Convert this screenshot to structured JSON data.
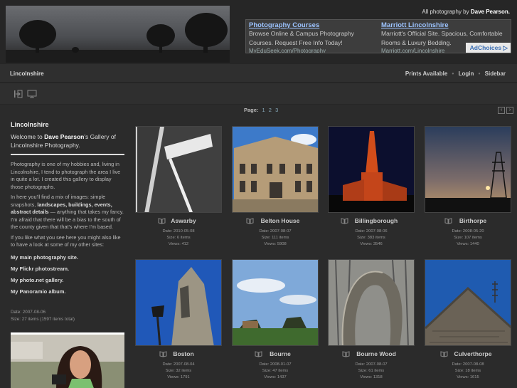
{
  "header": {
    "credit_prefix": "All photography by",
    "credit_name": "Dave Pearson."
  },
  "ad": {
    "items": [
      {
        "title": "Photography Courses",
        "body": "Browse Online & Campus Photography Courses. Request Free Info Today!",
        "url": "MyEduSeek.com/Photography"
      },
      {
        "title": "Marriott Lincolnshire",
        "body": "Marriott's Official Site. Spacious, Comfortable Rooms & Luxury Bedding.",
        "url": "Marriott.com/Lincolnshire"
      }
    ],
    "adchoices": "AdChoices"
  },
  "nav": {
    "breadcrumb": "Lincolnshire",
    "links": [
      "Prints Available",
      "Login",
      "Sidebar"
    ],
    "separator": "•"
  },
  "toolbar": {
    "icons": [
      "exit-gallery-icon",
      "slideshow-icon"
    ]
  },
  "pager": {
    "label": "Page:",
    "pages": [
      "1",
      "2",
      "3"
    ],
    "prev": "‹",
    "next": "›"
  },
  "sidebar": {
    "title": "Lincolnshire",
    "intro_welcome": "Welcome to",
    "intro_name": "Dave Pearson",
    "intro_rest": "'s Gallery of Lincolnshire Photography.",
    "p1": "Photography is one of my hobbies and, living in Lincolnshire, I tend to photograph the area I live in quite a lot. I created this gallery to display those photographs.",
    "p2_start": "In here you'll find a mix of images: simple snapshots,",
    "p2_bold": "landscapes, buildings, events, abstract details",
    "p2_end": "— anything that takes my fancy. I'm afraid that there will be a bias to the south of the county given that that's where I'm based.",
    "p3": "If you like what you see here you might also like to have a look at some of my other sites:",
    "links": [
      "My main photography site.",
      "My Flickr photostream.",
      "My photo.net gallery.",
      "My Panoramio album."
    ],
    "meta_date": "Date: 2007-08-06",
    "meta_size": "Size: 27 items (1597 items total)"
  },
  "galleries": [
    {
      "title": "Aswarby",
      "date": "Date: 2010-05-08",
      "size": "Size: 6 items",
      "views": "Views: 412"
    },
    {
      "title": "Belton House",
      "date": "Date: 2007-08-07",
      "size": "Size: 111 items",
      "views": "Views: 5908"
    },
    {
      "title": "Billingborough",
      "date": "Date: 2007-08-06",
      "size": "Size: 383 items",
      "views": "Views: 3546"
    },
    {
      "title": "Birthorpe",
      "date": "Date: 2008-05-20",
      "size": "Size: 107 items",
      "views": "Views: 1440"
    },
    {
      "title": "Boston",
      "date": "Date: 2007-08-04",
      "size": "Size: 32 items",
      "views": "Views: 1791"
    },
    {
      "title": "Bourne",
      "date": "Date: 2008-01-07",
      "size": "Size: 47 items",
      "views": "Views: 1437"
    },
    {
      "title": "Bourne Wood",
      "date": "Date: 2007-08-07",
      "size": "Size: 61 items",
      "views": "Views: 1318"
    },
    {
      "title": "Culverthorpe",
      "date": "Date: 2007-08-08",
      "size": "Size: 18 items",
      "views": "Views: 1615"
    }
  ],
  "colors": {
    "background": "#2b2b2b",
    "link_blue": "#9cc3ff",
    "text": "#cccccc"
  }
}
